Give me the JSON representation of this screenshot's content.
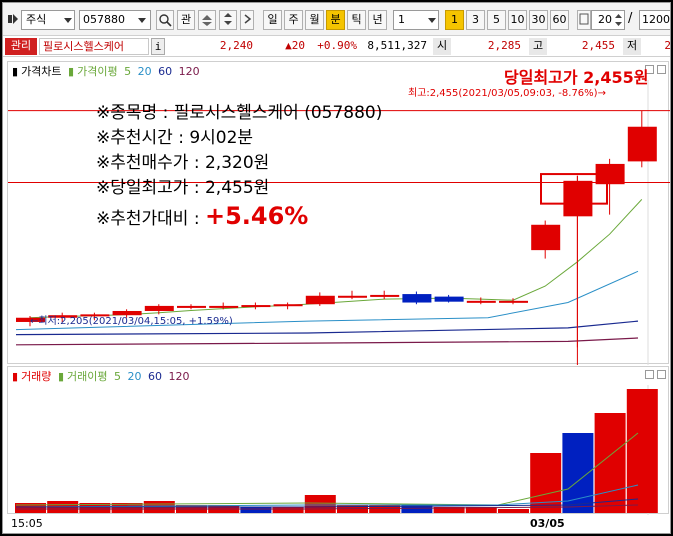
{
  "toolbar": {
    "market_label": "주식",
    "stock_code": "057880",
    "gwan_label": "관",
    "periods": [
      "일",
      "주",
      "월",
      "분",
      "틱",
      "년"
    ],
    "active_period": "분",
    "interval_value": "1",
    "interval_buttons": [
      "1",
      "3",
      "5",
      "10",
      "30",
      "60"
    ],
    "active_interval": "1",
    "count_value": "20",
    "slash": "/",
    "total_value": "1200"
  },
  "quote_bar": {
    "status_badge": "관리",
    "stock_name": "필로시스헬스케어",
    "info_btn": "i",
    "price": "2,240",
    "change": "▲20",
    "change_pct": "+0.90%",
    "volume": "8,511,327",
    "open_label": "시",
    "open_value": "2,285",
    "high_label": "고",
    "high_value": "2,455",
    "low_label": "저",
    "low_value": "2"
  },
  "price_panel": {
    "legend_title": "가격차트",
    "legend_ma_label": "가격이평",
    "legend_ma_values": [
      "5",
      "20",
      "60",
      "120"
    ],
    "day_high_headline": "당일최고가 2,455원",
    "high_annotation": "최고:2,455(2021/03/05,09:03, -8.76%)→",
    "low_annotation": "←최저:2,205(2021/03/04,15:05, +1.59%)"
  },
  "info_lines": {
    "line1": "※종목명 : 필로시스헬스케어 (057880)",
    "line2": "※추천시간 : 9시02분",
    "line3": "※추천매수가 : 2,320원",
    "line4": "※당일최고가 : 2,455원",
    "line5_prefix": "※추천가대비 : ",
    "line5_value": "+5.46%"
  },
  "volume_panel": {
    "legend_title": "거래량",
    "legend_ma_label": "거래이평",
    "legend_ma_values": [
      "5",
      "20",
      "60",
      "120"
    ]
  },
  "x_axis": {
    "left_label": "15:05",
    "date_label": "03/05"
  },
  "colors": {
    "up": "#e00000",
    "down": "#0020c0",
    "ma5": "#6aa83a",
    "ma20": "#2a8fc7",
    "ma60": "#1a2a90",
    "ma120": "#7a1a4a",
    "headline": "#e00000"
  },
  "chart_data": {
    "type": "candlestick",
    "categories": [
      "c1",
      "c2",
      "c3",
      "c4",
      "c5",
      "c6",
      "c7",
      "c8",
      "c9",
      "c10",
      "c11",
      "c12",
      "c13",
      "c14",
      "c15",
      "c16",
      "c17",
      "c18",
      "c19",
      "c20"
    ],
    "candles": [
      {
        "o": 2205,
        "h": 2212,
        "l": 2200,
        "c": 2210
      },
      {
        "o": 2210,
        "h": 2216,
        "l": 2205,
        "c": 2213
      },
      {
        "o": 2212,
        "h": 2216,
        "l": 2207,
        "c": 2214
      },
      {
        "o": 2213,
        "h": 2220,
        "l": 2210,
        "c": 2218
      },
      {
        "o": 2218,
        "h": 2226,
        "l": 2214,
        "c": 2224
      },
      {
        "o": 2224,
        "h": 2226,
        "l": 2220,
        "c": 2224
      },
      {
        "o": 2224,
        "h": 2228,
        "l": 2220,
        "c": 2224
      },
      {
        "o": 2224,
        "h": 2228,
        "l": 2220,
        "c": 2225
      },
      {
        "o": 2224,
        "h": 2228,
        "l": 2220,
        "c": 2226
      },
      {
        "o": 2226,
        "h": 2240,
        "l": 2224,
        "c": 2236
      },
      {
        "o": 2236,
        "h": 2242,
        "l": 2232,
        "c": 2236
      },
      {
        "o": 2236,
        "h": 2242,
        "l": 2232,
        "c": 2237
      },
      {
        "o": 2238,
        "h": 2241,
        "l": 2226,
        "c": 2228
      },
      {
        "o": 2235,
        "h": 2237,
        "l": 2228,
        "c": 2229
      },
      {
        "o": 2230,
        "h": 2234,
        "l": 2226,
        "c": 2230
      },
      {
        "o": 2230,
        "h": 2233,
        "l": 2226,
        "c": 2230
      },
      {
        "o": 2290,
        "h": 2325,
        "l": 2280,
        "c": 2320
      },
      {
        "o": 2330,
        "h": 2378,
        "l": 2175,
        "c": 2372
      },
      {
        "o": 2368,
        "h": 2398,
        "l": 2332,
        "c": 2392
      },
      {
        "o": 2395,
        "h": 2455,
        "l": 2388,
        "c": 2436
      }
    ],
    "volumes": [
      5,
      6,
      5,
      5,
      6,
      4,
      4,
      3,
      3,
      9,
      4,
      4,
      4,
      3,
      3,
      2,
      30,
      40,
      50,
      62
    ],
    "volume_colors": [
      "up",
      "up",
      "up",
      "up",
      "up",
      "up",
      "up",
      "down",
      "up",
      "up",
      "up",
      "up",
      "down",
      "up",
      "up",
      "up",
      "up",
      "down",
      "up",
      "up"
    ],
    "ylim": [
      2160,
      2470
    ],
    "xlabel": "",
    "ylabel": ""
  }
}
